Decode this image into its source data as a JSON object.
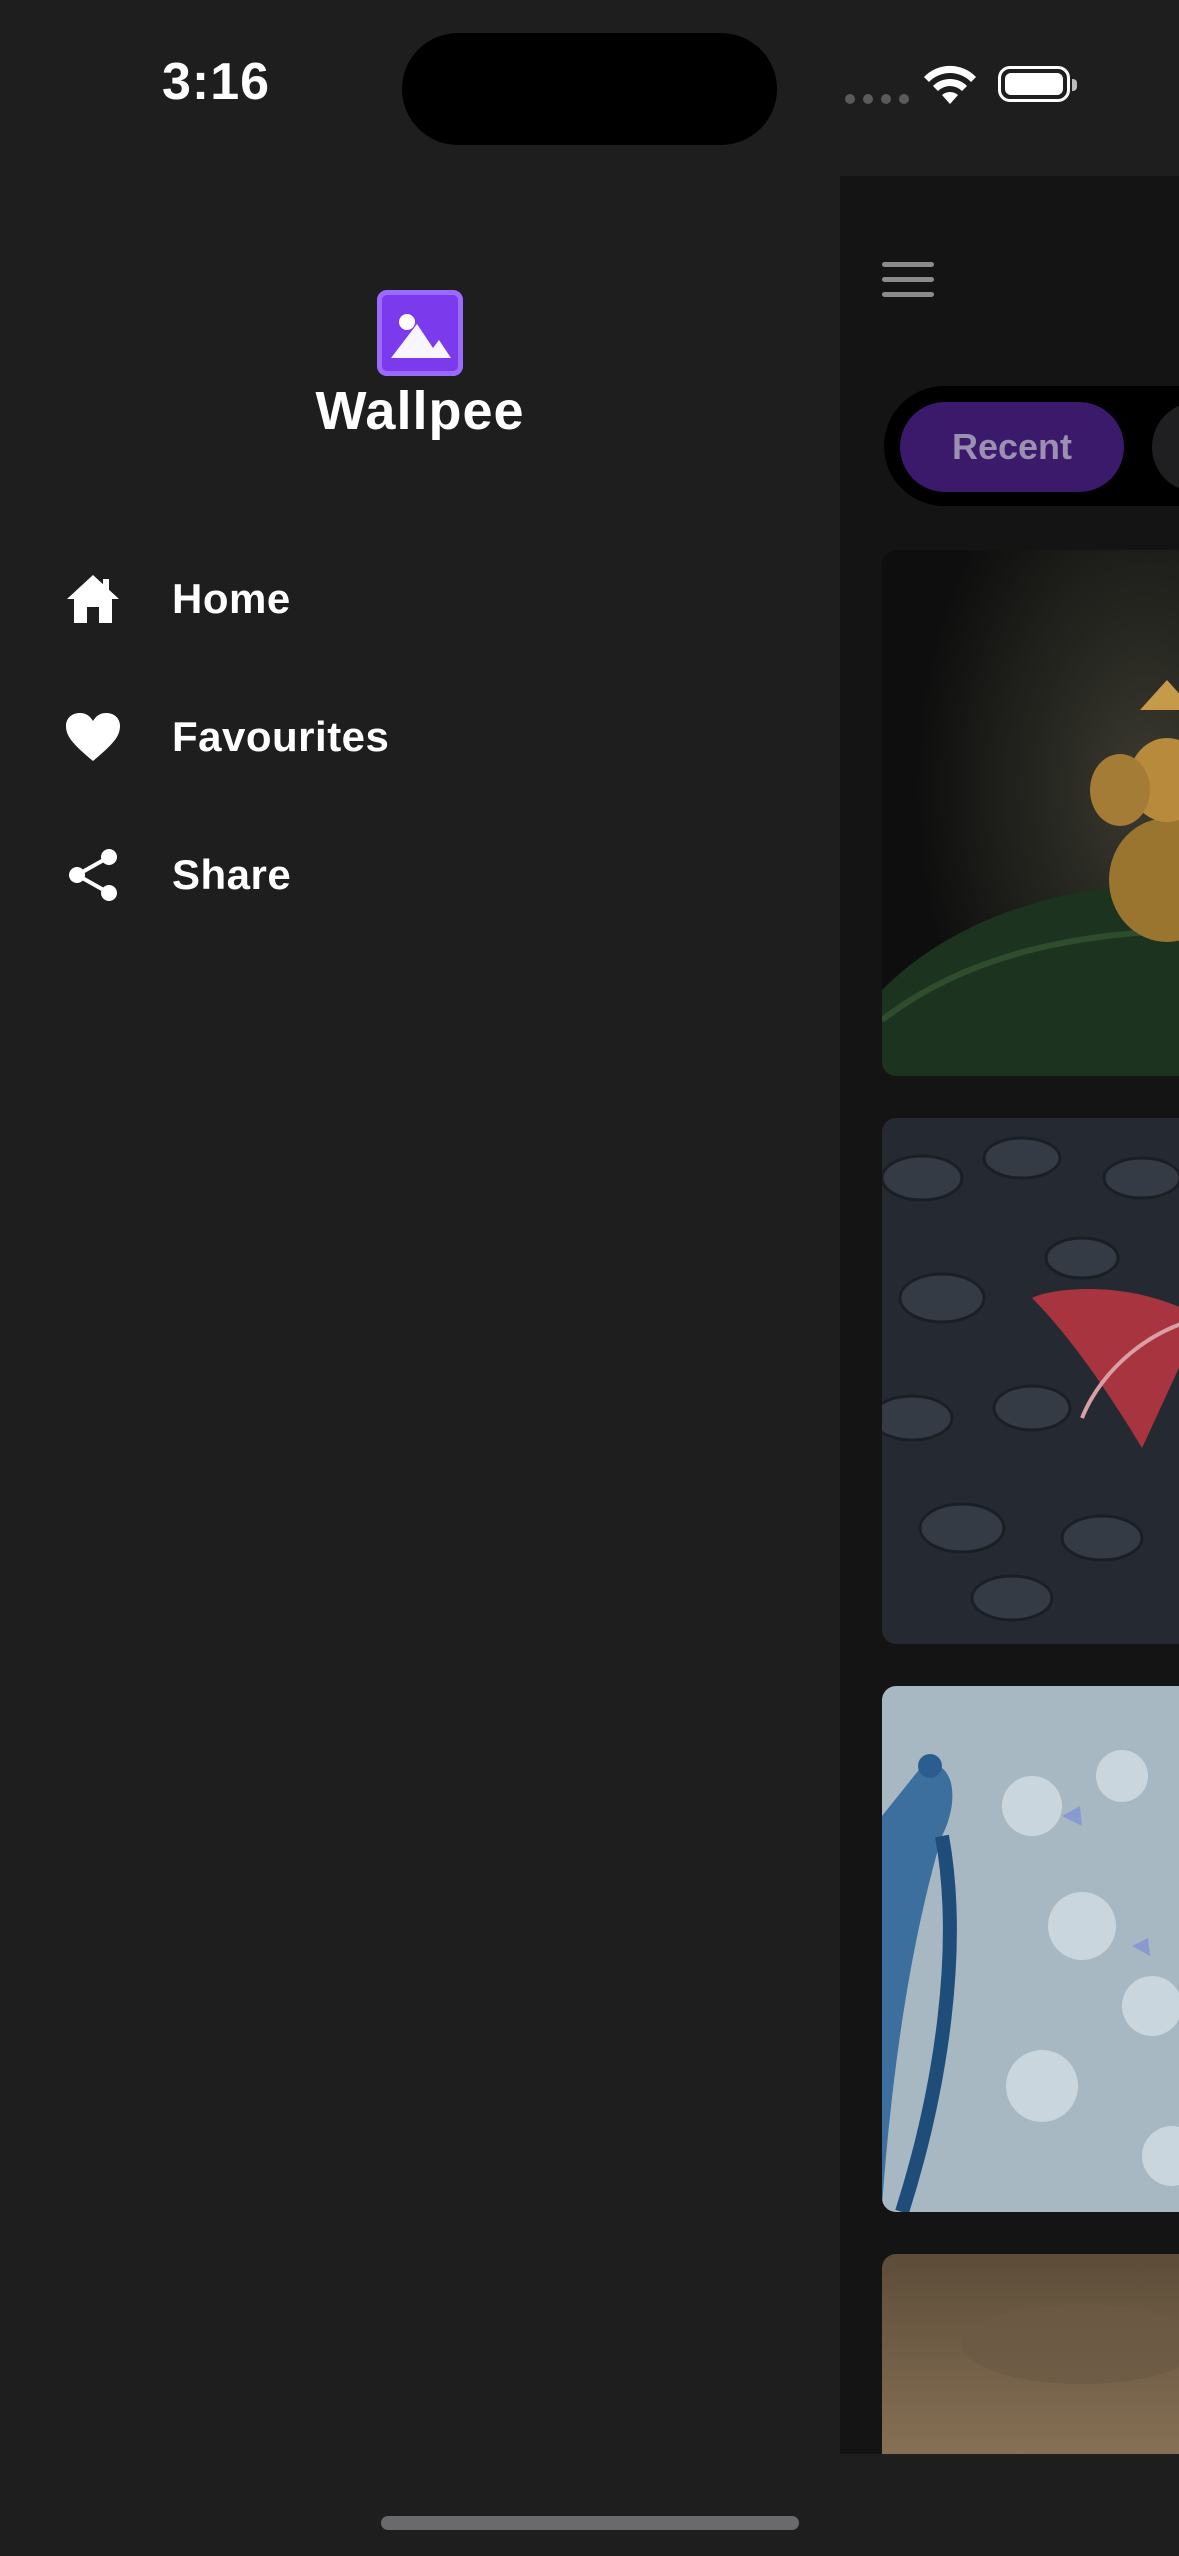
{
  "status_bar": {
    "time": "3:16"
  },
  "drawer": {
    "app_name": "Wallpee",
    "menu": [
      {
        "label": "Home",
        "icon": "home-icon"
      },
      {
        "label": "Favourites",
        "icon": "heart-icon"
      },
      {
        "label": "Share",
        "icon": "share-icon"
      }
    ]
  },
  "main": {
    "tabs": [
      {
        "label": "Recent",
        "selected": true
      }
    ],
    "wallpapers": [
      {
        "subject": "golden-ganesha-on-leaf"
      },
      {
        "subject": "red-butterfly-dark-leaves"
      },
      {
        "subject": "blue-peacock-flowers"
      },
      {
        "subject": "sepia-sky"
      }
    ]
  }
}
